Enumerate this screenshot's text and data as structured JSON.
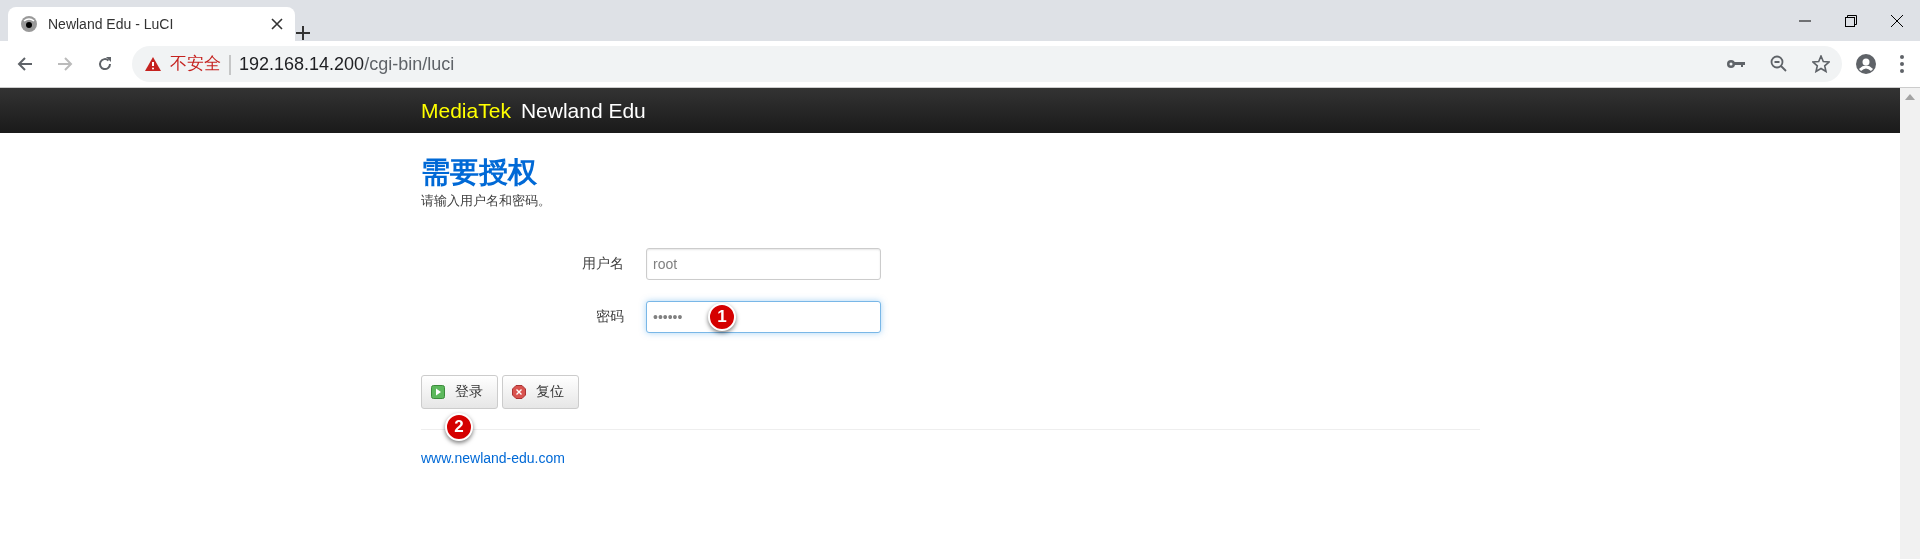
{
  "browser": {
    "tab": {
      "title": "Newland Edu - LuCI",
      "selected": true
    },
    "address": {
      "security": "不安全",
      "host": "192.168.14.200",
      "path": "/cgi-bin/luci"
    }
  },
  "header": {
    "brand": "MediaTek",
    "title": "Newland Edu"
  },
  "page": {
    "heading": "需要授权",
    "subtitle": "请输入用户名和密码。",
    "fields": [
      {
        "label": "用户名",
        "value": "root",
        "focused": false
      },
      {
        "label": "密码",
        "value": "••••••",
        "focused": true,
        "marker": "1"
      }
    ],
    "buttons": [
      {
        "label": "登录",
        "kind": "login",
        "marker": "2"
      },
      {
        "label": "复位",
        "kind": "reset"
      }
    ],
    "footer_link": "www.newland-edu.com"
  }
}
